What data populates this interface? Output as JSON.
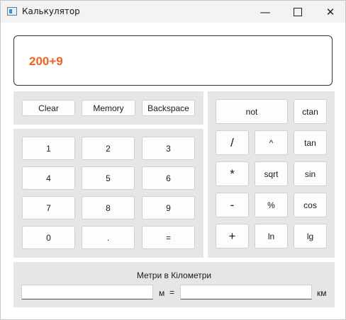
{
  "window": {
    "title": "Калькулятор"
  },
  "display": {
    "expression": "200+9"
  },
  "controls": {
    "clear": "Clear",
    "memory": "Memory",
    "backspace": "Backspace"
  },
  "keypad": [
    [
      "1",
      "2",
      "3"
    ],
    [
      "4",
      "5",
      "6"
    ],
    [
      "7",
      "8",
      "9"
    ],
    [
      "0",
      ".",
      "="
    ]
  ],
  "functions": {
    "not": "not",
    "ctan": "ctan",
    "divide": "/",
    "power": "^",
    "tan": "tan",
    "multiply": "*",
    "sqrt": "sqrt",
    "sin": "sin",
    "minus": "-",
    "percent": "%",
    "cos": "cos",
    "plus": "+",
    "ln": "ln",
    "lg": "lg"
  },
  "converter": {
    "title": "Метри в Кілометри",
    "meters_value": "",
    "meters_unit": "м",
    "equals": "=",
    "km_value": "",
    "km_unit": "км"
  }
}
